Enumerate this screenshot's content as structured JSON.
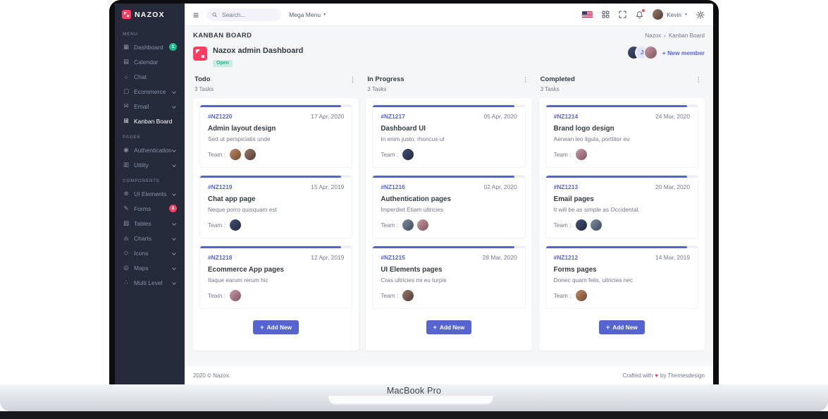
{
  "frame": {
    "device_label": "MacBook Pro"
  },
  "brand": {
    "name": "NAZOX"
  },
  "colors": {
    "accent": "#5664d2",
    "danger": "#ff3d60",
    "success": "#1cbb8c",
    "sidebar_bg": "#252b3b"
  },
  "topbar": {
    "search_placeholder": "Search...",
    "mega_menu_label": "Mega Menu",
    "user_name": "Kevin"
  },
  "sidebar": {
    "sections": [
      {
        "label": "MENU",
        "items": [
          {
            "label": "Dashboard",
            "icon": "dashboard-icon",
            "glyph": "▦",
            "badge": "1"
          },
          {
            "label": "Calendar",
            "icon": "calendar-icon",
            "glyph": "▤"
          },
          {
            "label": "Chat",
            "icon": "chat-icon",
            "glyph": "○"
          },
          {
            "label": "Ecommerce",
            "icon": "ecommerce-icon",
            "glyph": "▢",
            "expandable": true
          },
          {
            "label": "Email",
            "icon": "email-icon",
            "glyph": "✉",
            "expandable": true
          },
          {
            "label": "Kanban Board",
            "icon": "kanban-icon",
            "glyph": "⊞",
            "active": true
          }
        ]
      },
      {
        "label": "PAGES",
        "items": [
          {
            "label": "Authentication",
            "icon": "authentication-icon",
            "glyph": "◉",
            "expandable": true
          },
          {
            "label": "Utility",
            "icon": "utility-icon",
            "glyph": "▥",
            "expandable": true
          }
        ]
      },
      {
        "label": "COMPONENTS",
        "items": [
          {
            "label": "UI Elements",
            "icon": "ui-elements-icon",
            "glyph": "⊗",
            "expandable": true
          },
          {
            "label": "Forms",
            "icon": "forms-icon",
            "glyph": "✎",
            "badge": "8"
          },
          {
            "label": "Tables",
            "icon": "tables-icon",
            "glyph": "▧",
            "expandable": true
          },
          {
            "label": "Charts",
            "icon": "charts-icon",
            "glyph": "ılı",
            "expandable": true
          },
          {
            "label": "Icons",
            "icon": "icons-icon",
            "glyph": "◇",
            "expandable": true
          },
          {
            "label": "Maps",
            "icon": "maps-icon",
            "glyph": "◎",
            "expandable": true
          },
          {
            "label": "Multi Level",
            "icon": "multi-level-icon",
            "glyph": "∴",
            "expandable": true
          }
        ]
      }
    ]
  },
  "page": {
    "title": "KANBAN BOARD",
    "breadcrumb": {
      "items": [
        "Nazox",
        "Kanban Board"
      ],
      "separator": "›"
    }
  },
  "board": {
    "title": "Nazox admin Dashboard",
    "status": "Open",
    "member_initial": "J",
    "new_member_label": "+ New member"
  },
  "labels": {
    "team": "Team :",
    "add_new": "Add New",
    "plus": "+"
  },
  "columns": [
    {
      "name": "Todo",
      "count_label": "3 Tasks",
      "cards": [
        {
          "id": "#NZ1220",
          "date": "17 Apr, 2020",
          "title": "Admin layout design",
          "desc": "Sed ut perspiciatis unde",
          "team_count": 2,
          "progress_percent": 93
        },
        {
          "id": "#NZ1219",
          "date": "15 Apr, 2019",
          "title": "Chat app page",
          "desc": "Neque porro quisquam est",
          "team_count": 1,
          "progress_percent": 93
        },
        {
          "id": "#NZ1218",
          "date": "12 Apr, 2019",
          "title": "Ecommerce App pages",
          "desc": "Itaque earum rerum hic",
          "team_count": 1,
          "progress_percent": 93
        }
      ]
    },
    {
      "name": "In Progress",
      "count_label": "3 Tasks",
      "cards": [
        {
          "id": "#NZ1217",
          "date": "05 Apr, 2020",
          "title": "Dashboard UI",
          "desc": "In enim justo, rhoncus ut",
          "team_count": 1,
          "progress_percent": 93
        },
        {
          "id": "#NZ1216",
          "date": "02 Apr, 2020",
          "title": "Authentication pages",
          "desc": "Imperdiet Etiam ultricies",
          "team_count": 2,
          "progress_percent": 93
        },
        {
          "id": "#NZ1215",
          "date": "28 Mar, 2020",
          "title": "UI Elements pages",
          "desc": "Cras ultricies mi eu turpis",
          "team_count": 1,
          "progress_percent": 93
        }
      ]
    },
    {
      "name": "Completed",
      "count_label": "3 Tasks",
      "cards": [
        {
          "id": "#NZ1214",
          "date": "24 Mar, 2020",
          "title": "Brand logo design",
          "desc": "Aenean leo ligula, porttitor eu",
          "team_count": 1,
          "progress_percent": 93
        },
        {
          "id": "#NZ1213",
          "date": "20 Mar, 2020",
          "title": "Email pages",
          "desc": "It will be as simple as Occidental.",
          "team_count": 2,
          "progress_percent": 93
        },
        {
          "id": "#NZ1212",
          "date": "14 Mar, 2019",
          "title": "Forms pages",
          "desc": "Donec quam felis, ultricies nec",
          "team_count": 1,
          "progress_percent": 93
        }
      ]
    }
  ],
  "footer": {
    "left": "2020 © Nazox.",
    "right_prefix": "Crafted with",
    "heart": "♥",
    "right_suffix": "by Themesdesign"
  }
}
